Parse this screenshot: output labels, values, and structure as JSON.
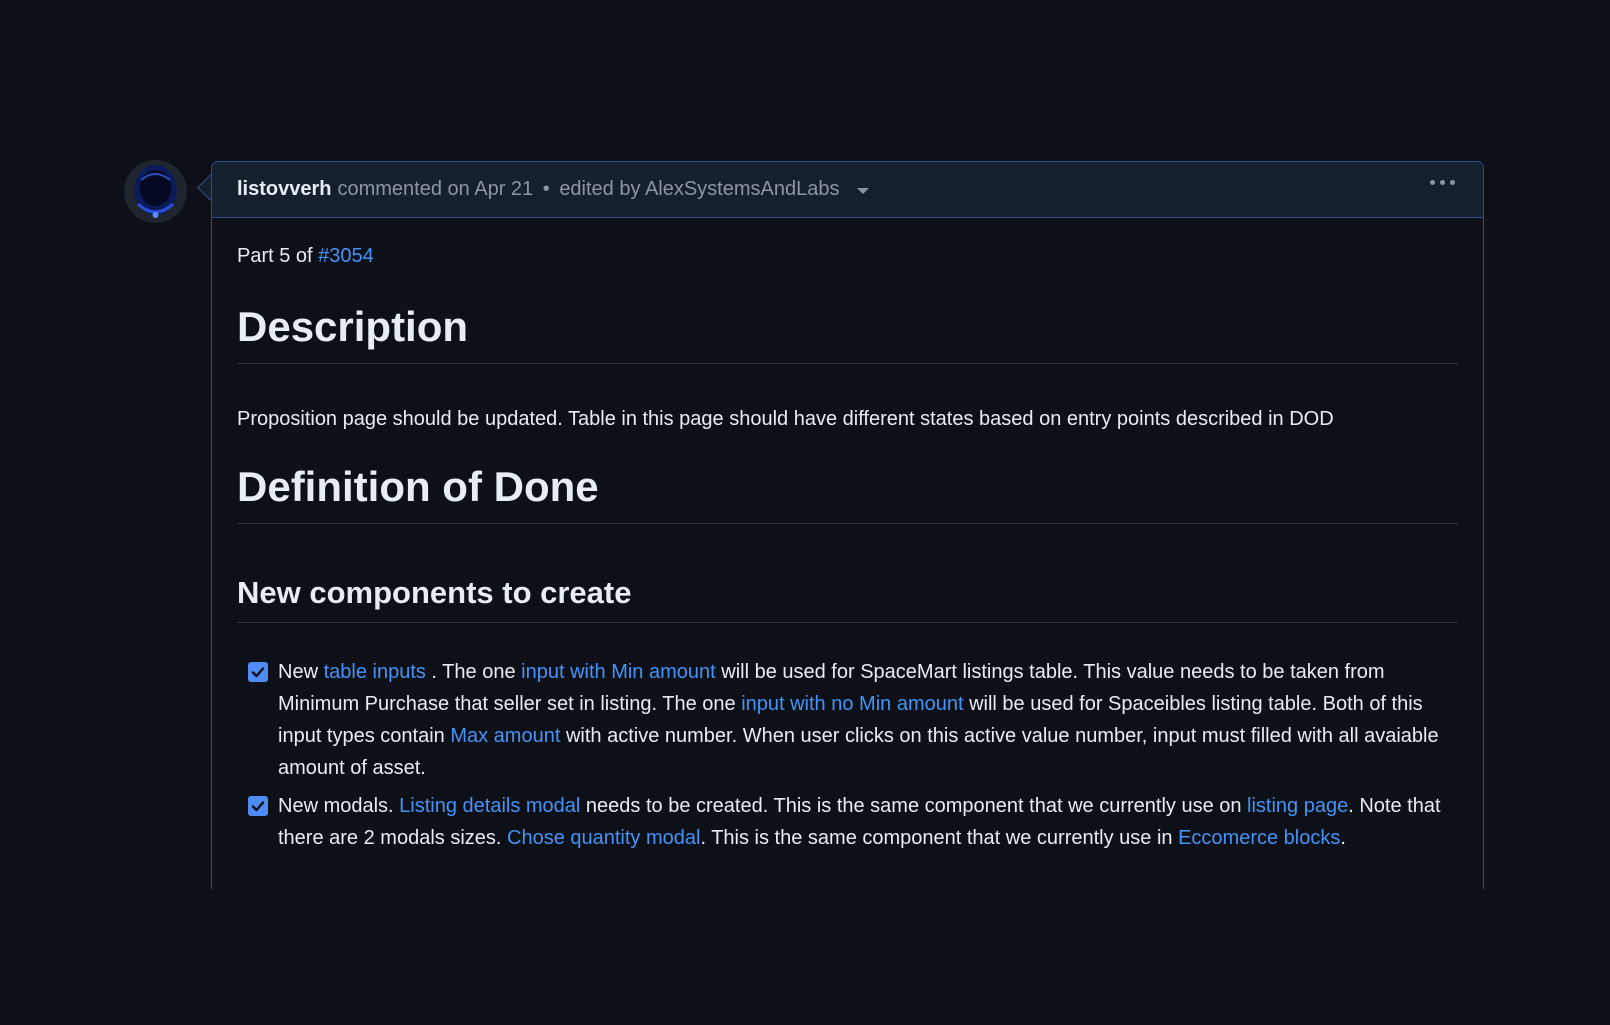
{
  "comment": {
    "author": "listovverh",
    "commented": "commented on Apr 21",
    "separator": "•",
    "edited": "edited by AlexSystemsAndLabs",
    "more_icon": "kebab-horizontal-icon",
    "avatar_icon": "astronaut-helmet-avatar"
  },
  "body": {
    "part_prefix": "Part 5 of ",
    "part_link": "#3054",
    "description_heading": "Description",
    "description_text": "Proposition page should be updated. Table in this page should have different states based on entry points described in DOD",
    "dod_heading": "Definition of Done",
    "components_heading": "New components to create",
    "tasks": [
      {
        "checked": true,
        "t1": "New ",
        "l1": "table inputs",
        "t2": " . The one ",
        "l2": "input with Min amount",
        "t3": " will be used for SpaceMart listings table. This value needs to be taken from Minimum Purchase that seller set in listing. The one ",
        "l3": "input with no Min amount",
        "t4": " will be used for Spaceibles listing table. Both of this input types contain ",
        "l4": "Max amount",
        "t5": " with active number. When user clicks on this active value number, input must filled with all avaiable amount of asset."
      },
      {
        "checked": true,
        "t1": "New modals. ",
        "l1": "Listing details modal",
        "t2": " needs to be created. This is the same component that we currently use on ",
        "l2": "listing page",
        "t3": ". Note that there are 2 modals sizes. ",
        "l3": "Chose quantity modal",
        "t4": ". This is the same component that we currently use in ",
        "l4": "Eccomerce blocks",
        "t5": "."
      }
    ]
  },
  "colors": {
    "background": "#0d1117",
    "header_bg": "#161f2e",
    "border": "#2f4f8a",
    "link": "#4493f8",
    "muted": "#8d96a0",
    "checkbox": "#4f8cf5"
  }
}
